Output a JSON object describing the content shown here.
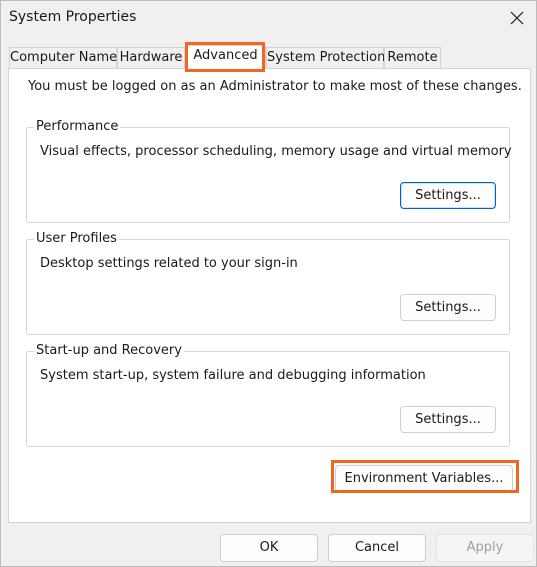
{
  "window": {
    "title": "System Properties"
  },
  "tabs": [
    {
      "label": "Computer Name"
    },
    {
      "label": "Hardware"
    },
    {
      "label": "Advanced"
    },
    {
      "label": "System Protection"
    },
    {
      "label": "Remote"
    }
  ],
  "active_tab": "Advanced",
  "advanced": {
    "admin_note": "You must be logged on as an Administrator to make most of these changes.",
    "performance": {
      "label": "Performance",
      "description": "Visual effects, processor scheduling, memory usage and virtual memory",
      "button": "Settings..."
    },
    "user_profiles": {
      "label": "User Profiles",
      "description": "Desktop settings related to your sign-in",
      "button": "Settings..."
    },
    "startup_recovery": {
      "label": "Start-up and Recovery",
      "description": "System start-up, system failure and debugging information",
      "button": "Settings..."
    },
    "env_button": "Environment Variables..."
  },
  "footer": {
    "ok": "OK",
    "cancel": "Cancel",
    "apply": "Apply"
  },
  "colors": {
    "highlight": "#f26522",
    "default_button_border": "#005fb8"
  }
}
